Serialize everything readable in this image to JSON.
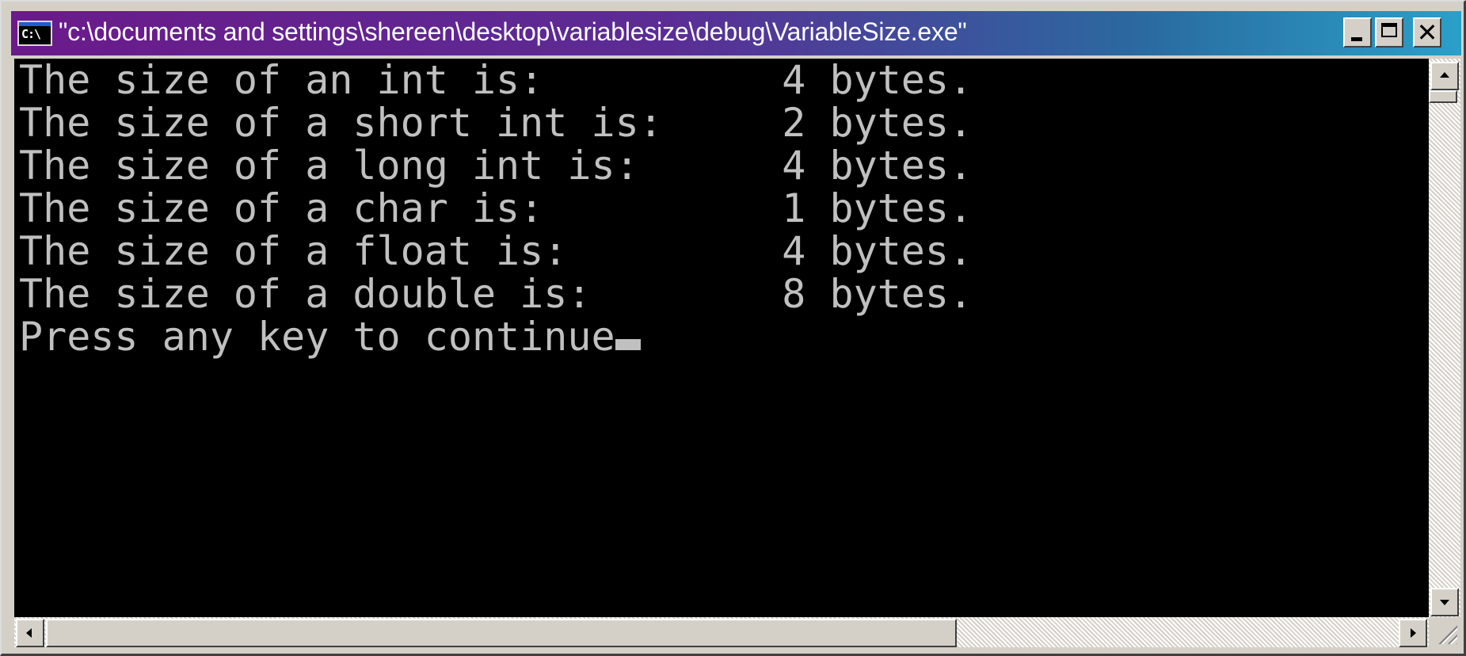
{
  "window": {
    "title": "\"c:\\documents and settings\\shereen\\desktop\\variablesize\\debug\\VariableSize.exe\"",
    "icon": "console-icon",
    "icon_text": "C:\\",
    "controls": {
      "minimize": "minimize-icon",
      "maximize": "maximize-icon",
      "close_label": "✕"
    }
  },
  "console": {
    "lines": [
      "The size of an int is:          4 bytes.",
      "The size of a short int is:     2 bytes.",
      "The size of a long int is:      4 bytes.",
      "The size of a char is:          1 bytes.",
      "The size of a float is:         4 bytes.",
      "The size of a double is:        8 bytes.",
      "Press any key to continue"
    ]
  },
  "colors": {
    "console_bg": "#000000",
    "console_fg": "#c0c0c0",
    "title_start": "#6b1a8a",
    "title_end": "#2aa0c8"
  }
}
